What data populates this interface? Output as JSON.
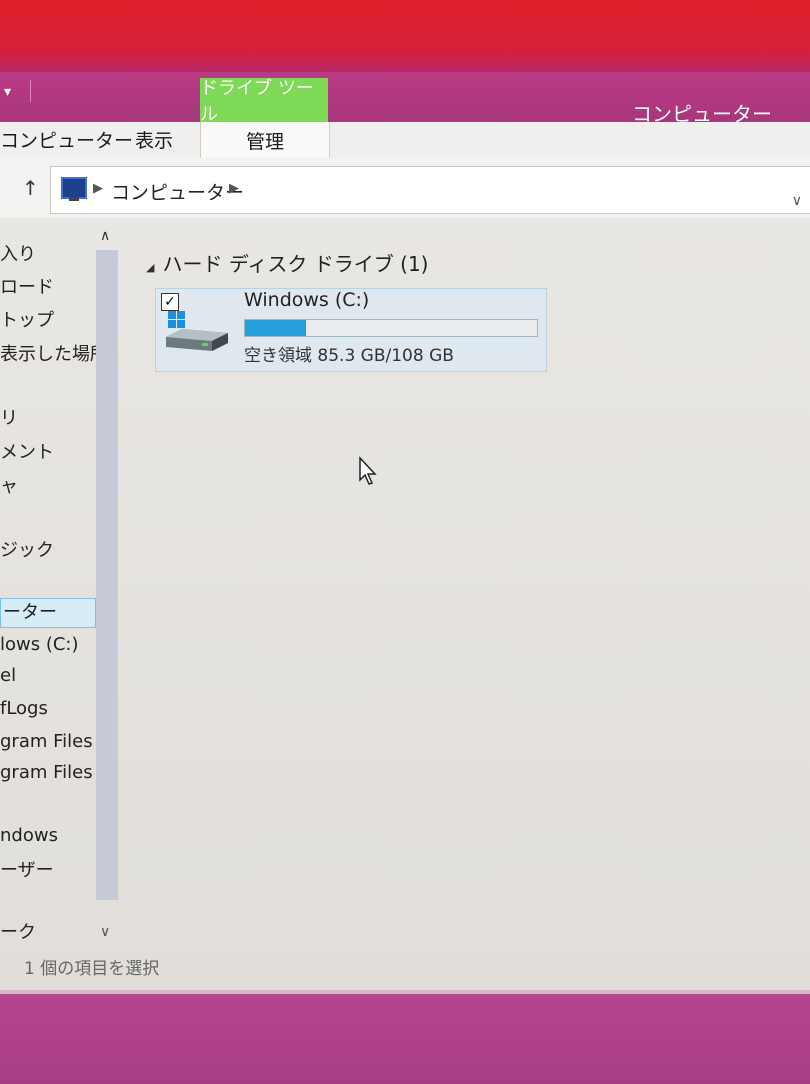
{
  "window": {
    "title": "コンピューター"
  },
  "ribbon": {
    "contextual_tab": "ドライブ ツール",
    "tabs": [
      "コンピューター",
      "表示",
      "管理"
    ]
  },
  "address": {
    "up_label": "↑",
    "breadcrumb": "コンピューター"
  },
  "nav": {
    "items": [
      "入り",
      "ロード",
      "トップ",
      "表示した場所",
      "リ",
      "メント",
      "ャ",
      "ジック",
      "ーター",
      "lows (C:)",
      "el",
      "fLogs",
      "gram Files",
      "gram Files",
      "ndows",
      "ーザー",
      "ーク"
    ],
    "selected_index": 8
  },
  "content": {
    "group_header": "ハード ディスク ドライブ (1)",
    "drive": {
      "name": "Windows (C:)",
      "free_space": "空き領域 85.3 GB/108 GB",
      "used_fraction": 0.21,
      "checked": true
    }
  },
  "status": {
    "text": "1 個の項目を選択"
  },
  "colors": {
    "accent_tab": "#7ed957",
    "capacity_fill": "#26a0da",
    "titlebar": "#b93a84"
  }
}
